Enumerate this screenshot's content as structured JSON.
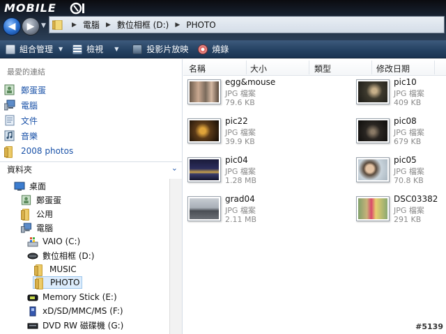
{
  "header": {
    "brand": "MOBILE",
    "breadcrumb": [
      "電腦",
      "數位相框 (D:)",
      "PHOTO"
    ]
  },
  "toolbar": {
    "organize": "組合管理",
    "views": "檢視",
    "slideshow": "投影片放映",
    "burn": "燒錄"
  },
  "favorites": {
    "heading": "最愛的連結",
    "items": [
      {
        "label": "鄭蛋蛋",
        "icon": "user-folder-icon"
      },
      {
        "label": "電腦",
        "icon": "computer-icon"
      },
      {
        "label": "文件",
        "icon": "documents-icon"
      },
      {
        "label": "音樂",
        "icon": "music-icon"
      },
      {
        "label": "2008 photos",
        "icon": "folder-icon"
      }
    ]
  },
  "folders": {
    "heading": "資料夾",
    "tree": [
      {
        "label": "桌面",
        "icon": "desktop-icon"
      },
      {
        "label": "鄭蛋蛋",
        "icon": "user-folder-icon"
      },
      {
        "label": "公用",
        "icon": "folder-icon"
      },
      {
        "label": "電腦",
        "icon": "computer-icon"
      },
      {
        "label": "VAIO (C:)",
        "icon": "windows-drive-icon"
      },
      {
        "label": "數位相框 (D:)",
        "icon": "drive-icon"
      },
      {
        "label": "MUSIC",
        "icon": "folder-icon"
      },
      {
        "label": "PHOTO",
        "icon": "folder-icon"
      },
      {
        "label": "Memory Stick (E:)",
        "icon": "memory-stick-icon"
      },
      {
        "label": "xD/SD/MMC/MS (F:)",
        "icon": "card-reader-icon"
      },
      {
        "label": "DVD RW 磁碟機 (G:)",
        "icon": "dvd-drive-icon"
      }
    ]
  },
  "columns": [
    "名稱",
    "大小",
    "類型",
    "修改日期"
  ],
  "files": [
    {
      "name": "egg&mouse",
      "type": "JPG 檔案",
      "size": "79.6 KB"
    },
    {
      "name": "pic10",
      "type": "JPG 檔案",
      "size": "409 KB"
    },
    {
      "name": "pic22",
      "type": "JPG 檔案",
      "size": "39.9 KB"
    },
    {
      "name": "pic08",
      "type": "JPG 檔案",
      "size": "679 KB"
    },
    {
      "name": "pic04",
      "type": "JPG 檔案",
      "size": "1.28 MB"
    },
    {
      "name": "pic05",
      "type": "JPG 檔案",
      "size": "70.8 KB"
    },
    {
      "name": "grad04",
      "type": "JPG 檔案",
      "size": "2.11 MB"
    },
    {
      "name": "DSC03382",
      "type": "JPG 檔案",
      "size": "291 KB"
    }
  ],
  "watermark": "#5139"
}
